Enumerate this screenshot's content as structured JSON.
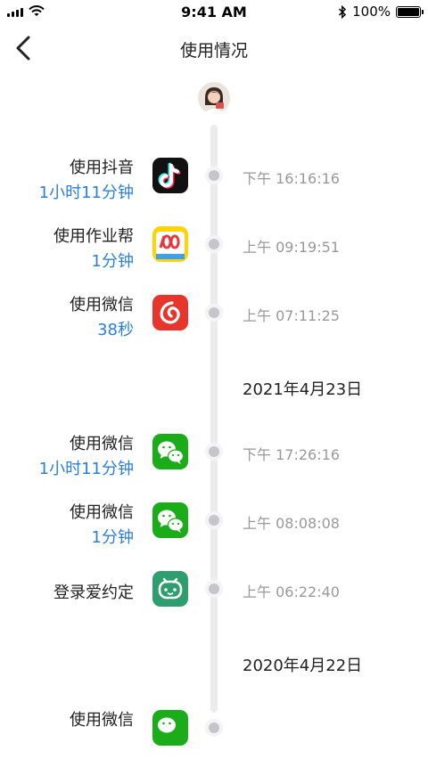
{
  "status_bar": {
    "time": "9:41 AM",
    "battery": "100%",
    "battery_level": 1.0
  },
  "nav": {
    "title": "使用情况"
  },
  "colors": {
    "accent": "#2c7fd7",
    "time_text": "#999999",
    "timeline": "#ececec"
  },
  "groups": [
    {
      "date": "",
      "entries": [
        {
          "title": "使用抖音",
          "duration": "1小时11分钟",
          "icon": "douyin-icon",
          "time": "下午 16:16:16"
        },
        {
          "title": "使用作业帮",
          "duration": "1分钟",
          "icon": "zuoyebang-icon",
          "time": "上午 09:19:51"
        },
        {
          "title": "使用微信",
          "duration": "38秒",
          "icon": "netease-music-icon",
          "time": "上午 07:11:25"
        }
      ]
    },
    {
      "date": "2021年4月23日",
      "entries": [
        {
          "title": "使用微信",
          "duration": "1小时11分钟",
          "icon": "wechat-icon",
          "time": "下午 17:26:16"
        },
        {
          "title": "使用微信",
          "duration": "1分钟",
          "icon": "wechat-icon",
          "time": "上午 08:08:08"
        },
        {
          "title": "登录爱约定",
          "duration": "",
          "icon": "aiyueding-icon",
          "time": "上午 06:22:40"
        }
      ]
    },
    {
      "date": "2020年4月22日",
      "entries": [
        {
          "title": "使用微信",
          "duration": "",
          "icon": "wechat-icon",
          "time": ""
        }
      ]
    }
  ]
}
